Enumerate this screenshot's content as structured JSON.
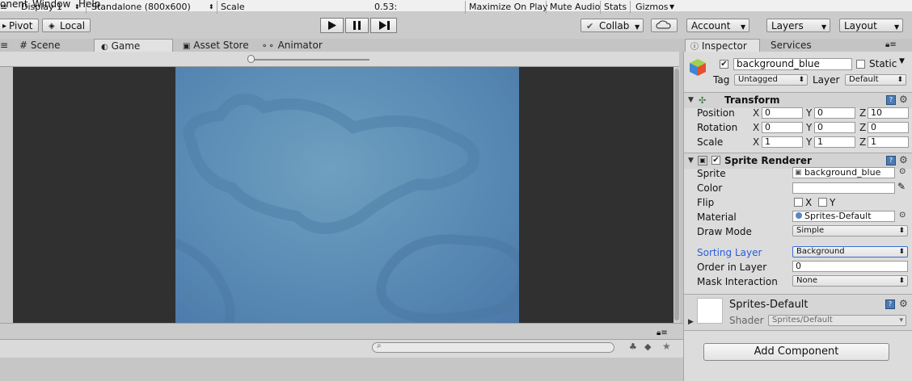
{
  "menu": [
    "onent",
    "Window",
    "Help"
  ],
  "toolbar": {
    "pivot": "Pivot",
    "local": "Local",
    "collab": "Collab",
    "account": "Account",
    "layers": "Layers",
    "layout": "Layout"
  },
  "tabs": {
    "scene": "Scene",
    "game": "Game",
    "asset_store": "Asset Store",
    "animator": "Animator",
    "inspector": "Inspector",
    "services": "Services"
  },
  "game_toolbar": {
    "display": "Display 1",
    "resolution": "Standalone (800x600)",
    "scale_label": "Scale",
    "scale_value": "0.53:",
    "scale_fraction": 0.0,
    "maximize": "Maximize On Play",
    "mute": "Mute Audio",
    "stats": "Stats",
    "gizmos": "Gizmos"
  },
  "inspector": {
    "object_name": "background_blue",
    "active": true,
    "static_label": "Static",
    "static": false,
    "tag_label": "Tag",
    "tag": "Untagged",
    "layer_label": "Layer",
    "layer": "Default",
    "transform": {
      "title": "Transform",
      "position_label": "Position",
      "rotation_label": "Rotation",
      "scale_label": "Scale",
      "position": [
        "0",
        "0",
        "10"
      ],
      "rotation": [
        "0",
        "0",
        "0"
      ],
      "scale": [
        "1",
        "1",
        "1"
      ],
      "axes": [
        "X",
        "Y",
        "Z"
      ]
    },
    "sprite_renderer": {
      "title": "Sprite Renderer",
      "enabled": true,
      "sprite_label": "Sprite",
      "sprite": "background_blue",
      "color_label": "Color",
      "color": "#ffffff",
      "flip_label": "Flip",
      "flip_x": "X",
      "flip_y": "Y",
      "material_label": "Material",
      "material": "Sprites-Default",
      "draw_mode_label": "Draw Mode",
      "draw_mode": "Simple",
      "sorting_layer_label": "Sorting Layer",
      "sorting_layer": "Background",
      "order_label": "Order in Layer",
      "order": "0",
      "mask_label": "Mask Interaction",
      "mask": "None"
    },
    "material_section": {
      "name": "Sprites-Default",
      "shader_label": "Shader",
      "shader": "Sprites/Default"
    },
    "add_component": "Add Component"
  },
  "colors": {
    "sorting_label": "#2a5dd8",
    "game_bg": "#303030",
    "sprite_blue": "#5b8db6"
  }
}
